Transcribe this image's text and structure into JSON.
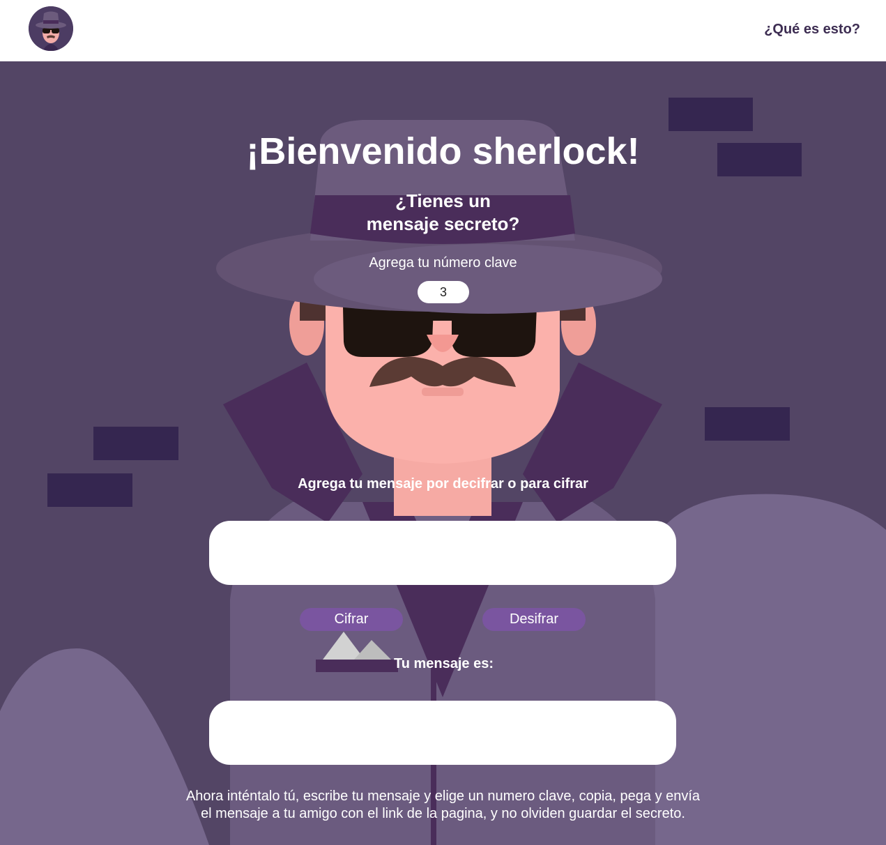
{
  "header": {
    "logo_icon": "detective-avatar-icon",
    "nav_link": "¿Qué es esto?"
  },
  "main": {
    "title": "¡Bienvenido sherlock!",
    "subtitle_line1": "¿Tienes un",
    "subtitle_line2": "mensaje secreto?",
    "key_label": "Agrega tu número clave",
    "key_value": "3",
    "message_label": "Agrega tu mensaje por decifrar o para cifrar",
    "message_value": "",
    "cipher_button": "Cifrar",
    "decipher_button": "Desifrar",
    "broken_image_icon": "broken-image-icon",
    "result_label": "Tu mensaje es:",
    "result_value": "",
    "instructions_line1": "Ahora inténtalo tú, escribe tu mensaje y elige un numero clave, copia, pega y envía",
    "instructions_line2": "el  mensaje a tu amigo con el link de la pagina, y no olviden guardar el secreto."
  },
  "colors": {
    "background": "#534565",
    "header_bg": "#ffffff",
    "accent": "#7a55a0",
    "nav_text": "#3d2d52",
    "hat": "#6c5b7d",
    "hat_band": "#4a2d5a",
    "skin": "#f8b0aa",
    "coat": "#4a2d5a",
    "bricks": "#352650"
  }
}
